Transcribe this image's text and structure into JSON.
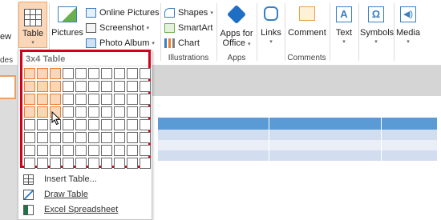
{
  "ribbon": {
    "partial_left_top": "ew",
    "partial_left_bottom": "des",
    "table_label": "Table",
    "pictures_label": "Pictures",
    "online_pictures": "Online Pictures",
    "screenshot": "Screenshot",
    "photo_album": "Photo Album",
    "shapes": "Shapes",
    "smartart": "SmartArt",
    "chart": "Chart",
    "illustrations_group": "Illustrations",
    "apps_line1": "Apps for",
    "apps_line2": "Office",
    "apps_group": "Apps",
    "links": "Links",
    "comment": "Comment",
    "comments_group": "Comments",
    "text": "Text",
    "symbols": "Symbols",
    "media": "Media"
  },
  "dropdown": {
    "size_label": "3x4 Table",
    "grid_rows": 8,
    "grid_cols": 10,
    "selected_rows": 4,
    "selected_cols": 3,
    "items": [
      {
        "label": "Insert Table...",
        "icon": "insert-table-icon"
      },
      {
        "label": "Draw Table",
        "icon": "draw-table-icon"
      },
      {
        "label": "Excel Spreadsheet",
        "icon": "excel-icon"
      }
    ]
  },
  "colors": {
    "accent_red": "#d0021b",
    "selected_cell": "#ee7c2f",
    "table_header": "#5b9bd5",
    "table_band": "#d2deef"
  }
}
